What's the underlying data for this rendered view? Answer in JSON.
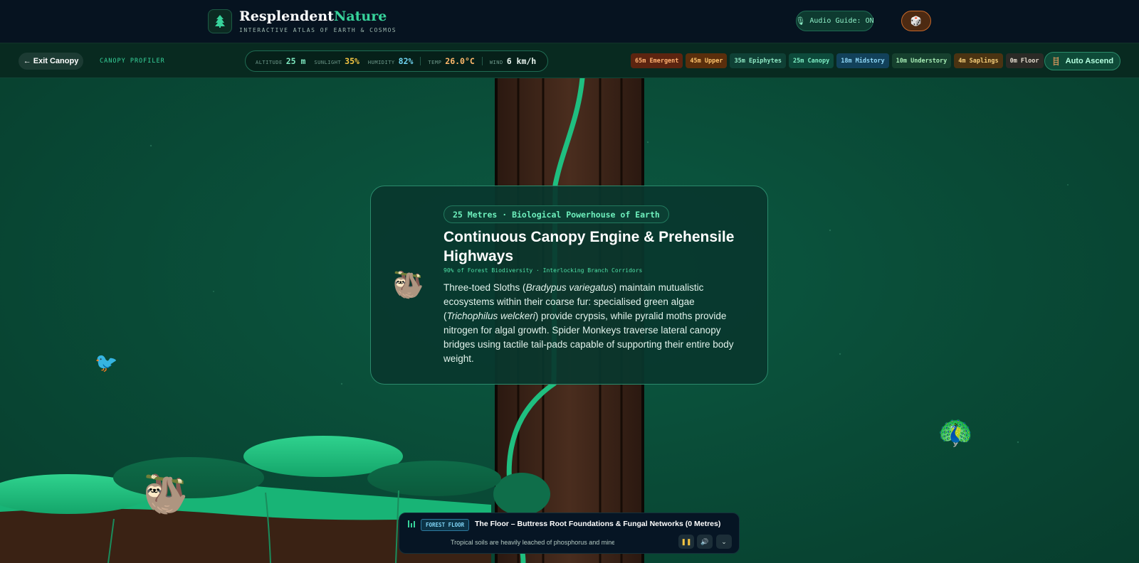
{
  "header": {
    "brand_name_primary": "Resplendent",
    "brand_name_accent": "Nature",
    "brand_tagline": "INTERACTIVE ATLAS OF EARTH & COSMOS",
    "audio_guide_label": "Audio Guide: ON",
    "logo_icon": "tree-icon",
    "dice_icon": "dice-icon"
  },
  "toolbar": {
    "exit_label": "← Exit Canopy",
    "profiler_label": "CANOPY PROFILER",
    "stats": [
      {
        "label": "ALTITUDE",
        "value": "25 m"
      },
      {
        "label": "SUNLIGHT",
        "value": "35%"
      },
      {
        "label": "HUMIDITY",
        "value": "82%"
      },
      {
        "label": "TEMP",
        "value": "26.0°C"
      },
      {
        "label": "WIND",
        "value": "6 km/h"
      }
    ],
    "levels": [
      {
        "label": "65m Emergent",
        "bg": "#5c2410",
        "fg": "#ffb070"
      },
      {
        "label": "45m Upper",
        "bg": "#5a2e0c",
        "fg": "#ffc46b"
      },
      {
        "label": "35m Epiphytes",
        "bg": "#0f4035",
        "fg": "#8ee8c4"
      },
      {
        "label": "25m Canopy",
        "bg": "#0d4a3b",
        "fg": "#7ff0c6"
      },
      {
        "label": "18m Midstory",
        "bg": "#12415a",
        "fg": "#8fd8f8"
      },
      {
        "label": "10m Understory",
        "bg": "#16402e",
        "fg": "#a6ecb5"
      },
      {
        "label": "4m Saplings",
        "bg": "#4a3312",
        "fg": "#f7cf7a"
      },
      {
        "label": "0m Floor",
        "bg": "#2b2a26",
        "fg": "#e6ddd0"
      }
    ],
    "auto_ascend_label": "Auto Ascend"
  },
  "card": {
    "badge": "25 Metres · Biological Powerhouse of Earth",
    "title": "Continuous Canopy Engine & Prehensile Highways",
    "subtitle": "90% of Forest Biodiversity · Interlocking Branch Corridors",
    "body_1": "Three-toed Sloths (",
    "species_1": "Bradypus variegatus",
    "body_2": ") maintain mutualistic ecosystems within their coarse fur: specialised green algae (",
    "species_2": "Trichophilus welckeri",
    "body_3": ") provide crypsis, while pyralid moths provide nitrogen for algal growth. Spider Monkeys traverse lateral canopy bridges using tactile tail-pads capable of supporting their entire body weight.",
    "emoji_icon": "sloth-icon"
  },
  "player": {
    "badge": "FOREST FLOOR",
    "title": "The Floor – Buttress Root Foundations & Fungal Networks (0 Metres)",
    "ticker": "Tropical soils are heavily leached of phosphorus and minerals by millennia",
    "pause_icon": "pause-icon",
    "volume_icon": "volume-icon",
    "collapse_icon": "chevron-down-icon"
  },
  "scene": {
    "animals": [
      "bird-icon",
      "peacock-icon",
      "sloth-icon"
    ]
  },
  "colors": {
    "accent": "#37d39b",
    "background": "#0a4a37",
    "header_bg": "#061320"
  }
}
